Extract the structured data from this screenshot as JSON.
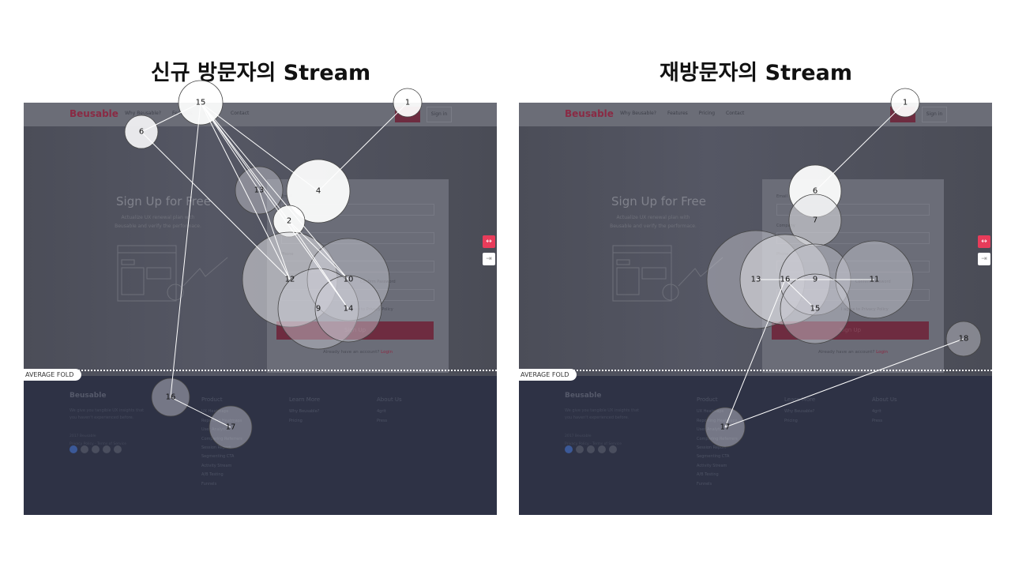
{
  "slide": {
    "left_title": "신규 방문자의 Stream",
    "right_title": "재방문자의 Stream"
  },
  "site": {
    "logo": "Beusable",
    "nav": [
      "Why Beusable?",
      "Features",
      "Pricing",
      "Contact"
    ],
    "sign_in": "Sign in",
    "hero_title": "Sign Up for Free",
    "hero_sub": "Actualize UX renewal plan with Beusable and verify the performace.",
    "form": {
      "email": "Email",
      "company": "Company",
      "phone": "Phone",
      "confirm": "Confirm Password",
      "agree": "I agree to Privacy Policy",
      "button": "Sign Up",
      "login_q": "Already have an account?",
      "login": "Login"
    },
    "footer": {
      "logo": "Beusable",
      "tagline": "We give you tangible UX insights that you haven't experienced before.",
      "copyright": "2017 Beusable",
      "legal": "Privacy Policy · Terms of Service",
      "product_title": "Product",
      "product": [
        "UX Heatmaps",
        "Reporting Heatmaps",
        "User Analytics",
        "Comparing Referrers",
        "Session Report",
        "Segmenting CTA",
        "Activity Stream",
        "A/B Testing",
        "Funnels"
      ],
      "learn_title": "Learn More",
      "learn": [
        "Why Beusable?",
        "Pricing"
      ],
      "about_title": "About Us",
      "about": [
        "4grit",
        "Press"
      ]
    },
    "fold_label": "AVERAGE FOLD"
  },
  "colors": {
    "brand": "#8a2a44",
    "toggle_active": "#e83c5a",
    "footer_bg": "#2e3245"
  },
  "left_stream": {
    "points": [
      "15",
      "1",
      "6",
      "13",
      "4",
      "2",
      "12",
      "10",
      "9",
      "14",
      "16",
      "17"
    ]
  },
  "right_stream": {
    "points": [
      "1",
      "6",
      "7",
      "13",
      "16",
      "9",
      "11",
      "15",
      "18",
      "17"
    ]
  }
}
